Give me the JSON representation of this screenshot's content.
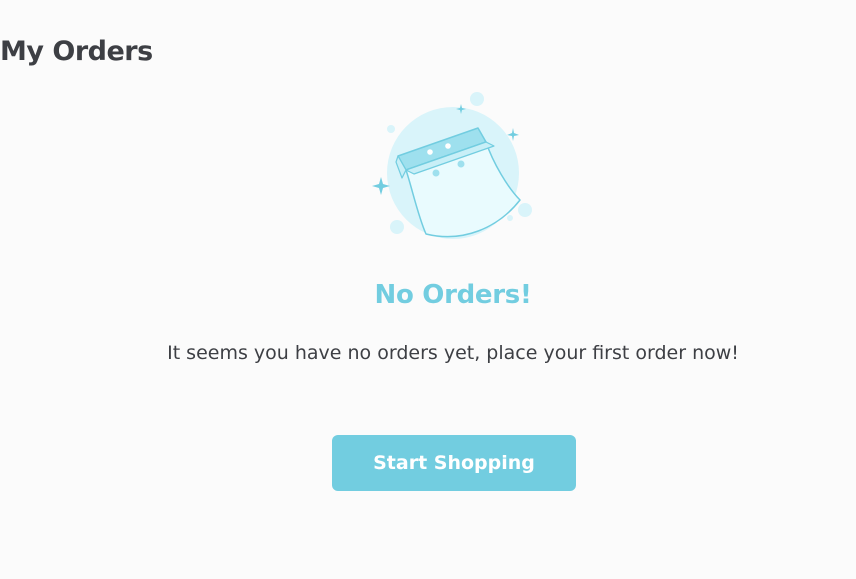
{
  "header": {
    "title": "My Orders"
  },
  "empty_state": {
    "illustration_icon": "shopping-bag-icon",
    "title": "No Orders!",
    "message": "It seems you have no orders yet, place your first order now!",
    "button_label": "Start Shopping"
  },
  "colors": {
    "accent": "#72cde0",
    "text": "#3d3f44",
    "background": "#fbfbfb",
    "illustration_circle": "#d9f4fa"
  }
}
